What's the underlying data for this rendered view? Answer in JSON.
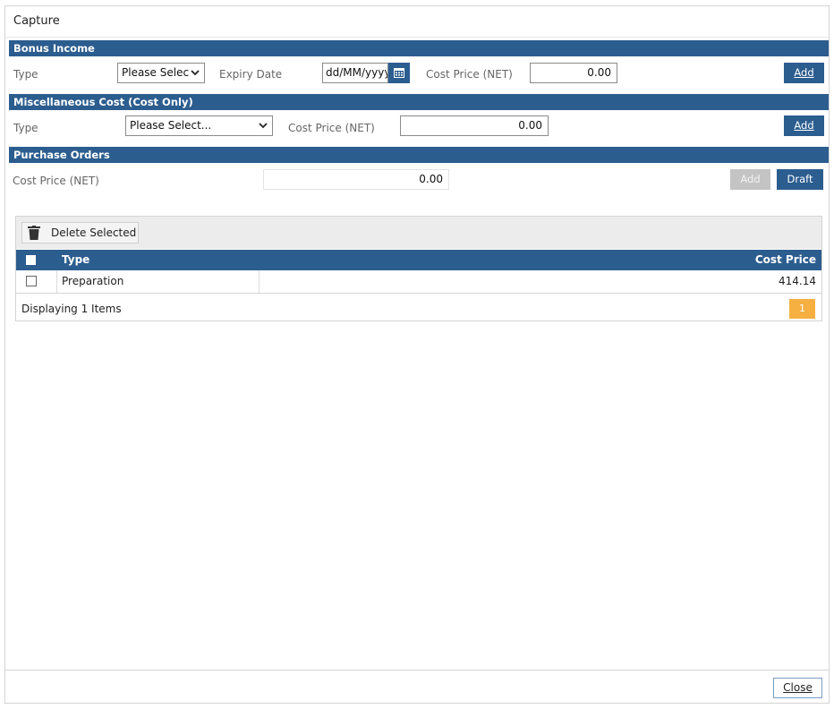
{
  "window": {
    "title": "Capture"
  },
  "bonus_income": {
    "header": "Bonus Income",
    "type_label": "Type",
    "type_value": "Please Selec",
    "expiry_label": "Expiry Date",
    "expiry_value": "dd/MM/yyyy",
    "cost_label": "Cost Price (NET)",
    "cost_value": "0.00",
    "add_label": "Add"
  },
  "misc_cost": {
    "header": "Miscellaneous Cost (Cost Only)",
    "type_label": "Type",
    "type_value": "Please Select...",
    "cost_label": "Cost Price (NET)",
    "cost_value": "0.00",
    "add_label": "Add"
  },
  "purchase_orders": {
    "header": "Purchase Orders",
    "cost_label": "Cost Price (NET)",
    "cost_value": "0.00",
    "add_label": "Add",
    "draft_label": "Draft"
  },
  "grid": {
    "delete_label": "Delete Selected",
    "columns": {
      "type": "Type",
      "cost_price": "Cost Price"
    },
    "rows": [
      {
        "type": "Preparation",
        "cost_price": "414.14",
        "checked": false
      }
    ],
    "footer": "Displaying 1 Items",
    "current_page": "1"
  },
  "close_label": "Close",
  "icons": {
    "calendar": "calendar-icon",
    "trash": "trash-icon",
    "dropdown": "chevron-down-icon"
  },
  "colors": {
    "header_blue": "#2c5d8f",
    "disabled_grey": "#c4c4c4",
    "page_orange": "#f5b041"
  }
}
